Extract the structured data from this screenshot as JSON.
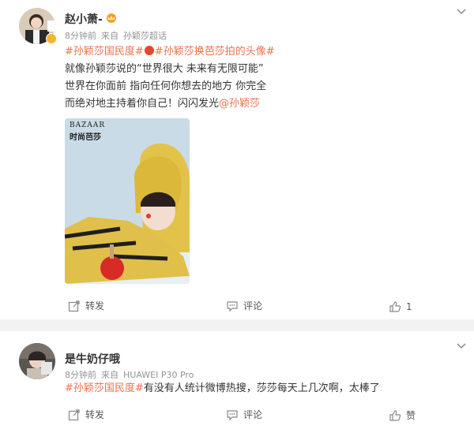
{
  "posts": [
    {
      "author": "赵小萧-",
      "time": "8分钟前",
      "source_prefix": "来自",
      "source": "孙颖莎超话",
      "text": {
        "hashtag1": "#孙颖莎国民度#",
        "hashtag2": "#孙颖莎换芭莎拍的头像#",
        "line1": "就像孙颖莎说的“世界很大 未来有无限可能”",
        "line2": "世界在你面前 指向任何你想去的地方 你完全",
        "line3_prefix": "而绝对地主持着你自己！闪闪发光",
        "mention": "@孙颖莎"
      },
      "image": {
        "brand_en": "BAZAAR",
        "brand_cn": "时尚芭莎"
      },
      "actions": {
        "repost": "转发",
        "comment": "评论",
        "like": "1"
      }
    },
    {
      "author": "是牛奶仔哦",
      "time": "8分钟前",
      "source_prefix": "来自",
      "source": "HUAWEI P30 Pro",
      "text": {
        "hashtag": "#孙颖莎国民度#",
        "body": "有没有人统计微博热搜，莎莎每天上几次啊，太棒了"
      },
      "actions": {
        "repost": "转发",
        "comment": "评论",
        "like": "赞"
      }
    }
  ],
  "colors": {
    "link": "#eb7350",
    "meta": "#939393",
    "text": "#333333"
  }
}
